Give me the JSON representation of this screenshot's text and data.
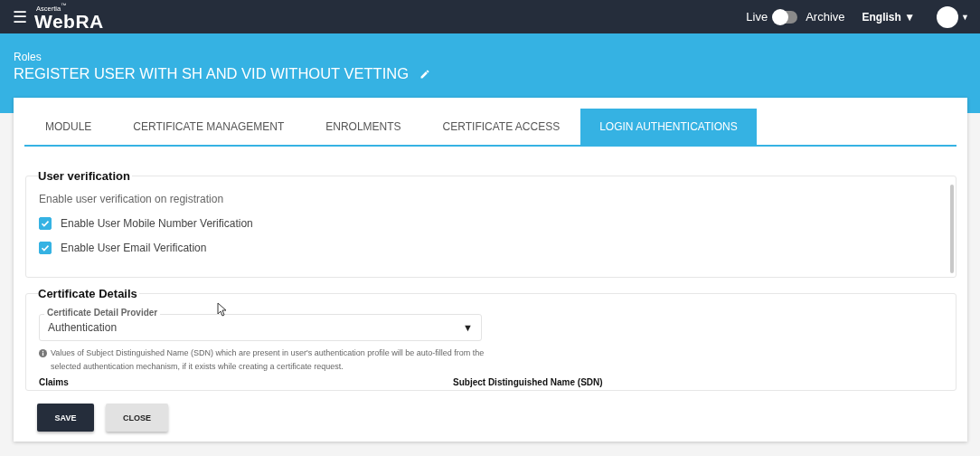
{
  "topbar": {
    "menu_icon": "☰",
    "brand_small": "Ascertia$^{™}$",
    "brand": "WebRA",
    "live_label": "Live",
    "archive_on": false,
    "archive_label": "Archive",
    "language": "English",
    "language_caret": "▼",
    "profile_caret": "▼"
  },
  "header": {
    "breadcrumb": "Roles",
    "title": "REGISTER USER WITH SH AND VID WITHOUT VETTING"
  },
  "tabs": [
    {
      "label": "MODULE",
      "selected": false
    },
    {
      "label": "CERTIFICATE MANAGEMENT",
      "selected": false
    },
    {
      "label": "ENROLMENTS",
      "selected": false
    },
    {
      "label": "CERTIFICATE ACCESS",
      "selected": false
    },
    {
      "label": "LOGIN AUTHENTICATIONS",
      "selected": true
    }
  ],
  "user_verification": {
    "title": "User verification",
    "description": "Enable user verification on registration",
    "options": [
      {
        "label": "Enable User Mobile Number Verification",
        "checked": true
      },
      {
        "label": "Enable User Email Verification",
        "checked": true
      }
    ]
  },
  "certificate_details": {
    "title": "Certificate Details",
    "provider": {
      "label": "Certificate Detail Provider",
      "value": "Authentication",
      "caret": "▼"
    },
    "note": "Values of Subject Distinguished Name (SDN) which are present in user's authentication profile will be auto-filled from the selected authentication mechanism, if it exists while creating a certificate request.",
    "columns": [
      "Claims",
      "Subject Distinguished Name (SDN)"
    ]
  },
  "buttons": [
    {
      "label": "SAVE",
      "kind": "primary"
    },
    {
      "label": "CLOSE",
      "kind": "secondary"
    }
  ]
}
